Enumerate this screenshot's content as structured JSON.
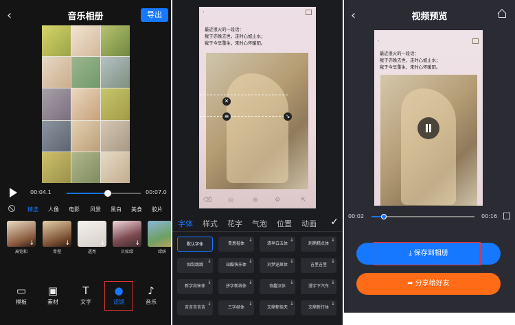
{
  "panel1": {
    "title": "音乐相册",
    "export_label": "导出",
    "time_current": "00:04.1",
    "time_total": "00:07.0",
    "progress": 0.56,
    "filter_categories": [
      "精选",
      "人像",
      "电影",
      "风景",
      "黑白",
      "美食",
      "胶片"
    ],
    "active_category": "精选",
    "filters": [
      "高饱和",
      "青橙",
      "透亮",
      "贝松绿",
      "绿妍"
    ],
    "toolbar": [
      {
        "label": "模板",
        "icon": "template-icon"
      },
      {
        "label": "素材",
        "icon": "material-icon"
      },
      {
        "label": "文字",
        "icon": "text-icon"
      },
      {
        "label": "滤镜",
        "icon": "filter-icon"
      },
      {
        "label": "音乐",
        "icon": "music-icon"
      }
    ],
    "active_tool": "滤镜"
  },
  "panel2": {
    "preview_text": "最近很火的一段话：\n我于亦晚去世，走时心如止水；\n我于今早重生，来时心怀暖阳。",
    "tabs": [
      "字体",
      "样式",
      "花字",
      "气泡",
      "位置",
      "动画"
    ],
    "active_tab": "字体",
    "fonts": [
      "默认字体",
      "青葱楷体",
      "清早白五体",
      "刺鹊精点体",
      "如梨跳跳",
      "站酷快乐体",
      "刘梦涵草体",
      "吉里吉里",
      "新字尚宋体",
      "拼字新线体",
      "奇趣汉体",
      "漫字下汽车",
      "吉吉吉吉吉",
      "三字经体",
      "文鼎郁佰天",
      "文鼎新行体"
    ]
  },
  "panel3": {
    "title": "视频预览",
    "preview_text": "最近很火的一段话：\n我于亦晚去世，走时心如止水；\n我于今早重生，来时心怀暖阳。",
    "time_current": "00:02",
    "time_total": "00:16",
    "progress": 0.12,
    "save_label": "保存到相册",
    "share_label": "分享给好友"
  }
}
